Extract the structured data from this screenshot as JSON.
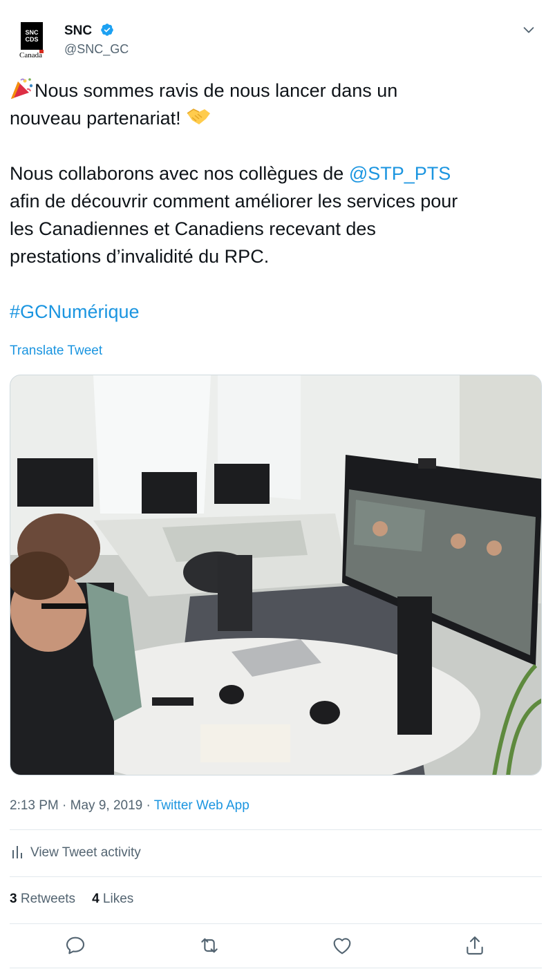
{
  "account": {
    "display_name": "SNC",
    "handle": "@SNC_GC",
    "logo_text_1": "SNC",
    "logo_text_2": "CDS",
    "logo_word": "Canada",
    "verified": true
  },
  "tweet": {
    "line1": "Nous sommes ravis de nous lancer dans un",
    "line2": "nouveau partenariat! ",
    "line3_pre": "Nous collaborons avec nos collègues de ",
    "mention": "@STP_PTS",
    "line4": "afin de découvrir comment améliorer les services pour",
    "line5": "les Canadiennes et Canadiens recevant des",
    "line6": "prestations d’invalidité du RPC.",
    "hashtag": "#GCNumérique",
    "emojis": [
      "party-popper-icon",
      "handshake-icon"
    ]
  },
  "translate_label": "Translate Tweet",
  "media": {
    "alt": "photo-office-video-call"
  },
  "meta": {
    "time": "2:13 PM",
    "sep": " · ",
    "date": "May 9, 2019",
    "sep2": " · ",
    "app": "Twitter Web App"
  },
  "activity_label": "View Tweet activity",
  "stats": {
    "retweets_count": "3",
    "retweets_label": " Retweets",
    "likes_count": "4",
    "likes_label": " Likes"
  },
  "colors": {
    "link": "#1b95e0",
    "muted": "#536471",
    "verified": "#1da1f2"
  }
}
